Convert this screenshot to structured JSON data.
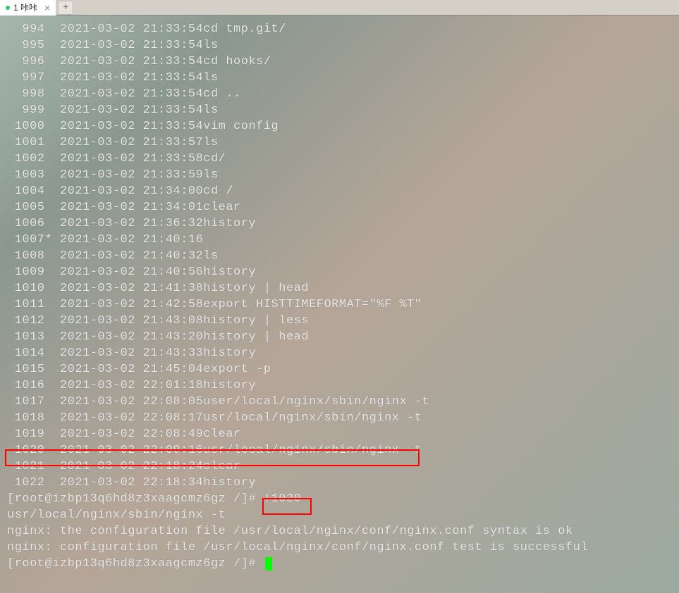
{
  "tab": {
    "label": "1 咔咔",
    "add_symbol": "+",
    "close_symbol": "×"
  },
  "history": [
    {
      "num": "  994",
      "date": "2021-03-02",
      "time": "21:33:54",
      "cmd": "cd tmp.git/"
    },
    {
      "num": "  995",
      "date": "2021-03-02",
      "time": "21:33:54",
      "cmd": "ls"
    },
    {
      "num": "  996",
      "date": "2021-03-02",
      "time": "21:33:54",
      "cmd": "cd hooks/"
    },
    {
      "num": "  997",
      "date": "2021-03-02",
      "time": "21:33:54",
      "cmd": "ls"
    },
    {
      "num": "  998",
      "date": "2021-03-02",
      "time": "21:33:54",
      "cmd": "cd .."
    },
    {
      "num": "  999",
      "date": "2021-03-02",
      "time": "21:33:54",
      "cmd": "ls"
    },
    {
      "num": " 1000",
      "date": "2021-03-02",
      "time": "21:33:54",
      "cmd": "vim config"
    },
    {
      "num": " 1001",
      "date": "2021-03-02",
      "time": "21:33:57",
      "cmd": "ls"
    },
    {
      "num": " 1002",
      "date": "2021-03-02",
      "time": "21:33:58",
      "cmd": "cd/"
    },
    {
      "num": " 1003",
      "date": "2021-03-02",
      "time": "21:33:59",
      "cmd": "ls"
    },
    {
      "num": " 1004",
      "date": "2021-03-02",
      "time": "21:34:00",
      "cmd": "cd /"
    },
    {
      "num": " 1005",
      "date": "2021-03-02",
      "time": "21:34:01",
      "cmd": "clear"
    },
    {
      "num": " 1006",
      "date": "2021-03-02",
      "time": "21:36:32",
      "cmd": "history"
    },
    {
      "num": " 1007*",
      "date": "2021-03-02",
      "time": "21:40:16",
      "cmd": ""
    },
    {
      "num": " 1008",
      "date": "2021-03-02",
      "time": "21:40:32",
      "cmd": "ls"
    },
    {
      "num": " 1009",
      "date": "2021-03-02",
      "time": "21:40:56",
      "cmd": "history"
    },
    {
      "num": " 1010",
      "date": "2021-03-02",
      "time": "21:41:38",
      "cmd": "history | head"
    },
    {
      "num": " 1011",
      "date": "2021-03-02",
      "time": "21:42:58",
      "cmd": "export HISTTIMEFORMAT=\"%F %T\""
    },
    {
      "num": " 1012",
      "date": "2021-03-02",
      "time": "21:43:08",
      "cmd": "history | less"
    },
    {
      "num": " 1013",
      "date": "2021-03-02",
      "time": "21:43:20",
      "cmd": "history | head"
    },
    {
      "num": " 1014",
      "date": "2021-03-02",
      "time": "21:43:33",
      "cmd": "history"
    },
    {
      "num": " 1015",
      "date": "2021-03-02",
      "time": "21:45:04",
      "cmd": "export -p"
    },
    {
      "num": " 1016",
      "date": "2021-03-02",
      "time": "22:01:18",
      "cmd": "history"
    },
    {
      "num": " 1017",
      "date": "2021-03-02",
      "time": "22:08:05",
      "cmd": "user/local/nginx/sbin/nginx -t"
    },
    {
      "num": " 1018",
      "date": "2021-03-02",
      "time": "22:08:17",
      "cmd": "usr/local/nginx/sbin/nginx -t"
    },
    {
      "num": " 1019",
      "date": "2021-03-02",
      "time": "22:08:49",
      "cmd": "clear"
    },
    {
      "num": " 1020",
      "date": "2021-03-02",
      "time": "22:09:16",
      "cmd": "usr/local/nginx/sbin/nginx -t"
    },
    {
      "num": " 1021",
      "date": "2021-03-02",
      "time": "22:18:24",
      "cmd": "clear"
    },
    {
      "num": " 1022",
      "date": "2021-03-02",
      "time": "22:18:34",
      "cmd": "history"
    }
  ],
  "prompt1": "[root@izbp13q6hd8z3xaagcmz6gz /]# ",
  "prompt1_cmd": "!1020",
  "output_lines": [
    "usr/local/nginx/sbin/nginx -t",
    "nginx: the configuration file /usr/local/nginx/conf/nginx.conf syntax is ok",
    "nginx: configuration file /usr/local/nginx/conf/nginx.conf test is successful"
  ],
  "prompt2": "[root@izbp13q6hd8z3xaagcmz6gz /]# "
}
